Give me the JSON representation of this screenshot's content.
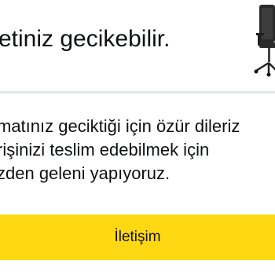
{
  "header": {
    "title": "etiniz gecikebilir.",
    "product_image_icon": "office-chair-icon"
  },
  "message": {
    "lines": [
      "matınız geciktiği için özür dileriz",
      "rişinizi teslim edebilmek için",
      "zden geleni yapıyoruz."
    ]
  },
  "actions": {
    "contact_label": "İletişim"
  },
  "colors": {
    "button_bg": "#ffd814",
    "divider": "#e3e6e6",
    "text": "#0f1111"
  }
}
